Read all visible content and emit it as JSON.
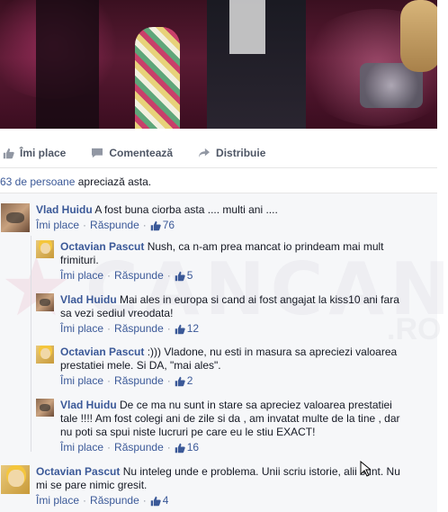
{
  "post_actions": {
    "like": "Îmi place",
    "comment": "Comentează",
    "share": "Distribuie"
  },
  "likes_summary": {
    "count_text": "63 de persoane",
    "suffix": " apreciază asta."
  },
  "watermark": {
    "text": "CANCAN",
    "suffix": ".RO"
  },
  "comments": [
    {
      "author": "Vlad Huidu",
      "text": "A fost buna ciorba asta .... multi ani ....",
      "like_label": "Îmi place",
      "reply_label": "Răspunde",
      "likes": "76"
    },
    {
      "author": "Octavian Pascut",
      "text_line1": "Nush, ca n-am prea mancat io prindeam mai mult",
      "text_line2": "frimituri.",
      "like_label": "Îmi place",
      "reply_label": "Răspunde",
      "likes": "5"
    },
    {
      "author": "Vlad Huidu",
      "text_line1": "Mai ales in europa si cand ai fost angajat la kiss10 ani fara",
      "text_line2": "sa vezi sediul vreodata!",
      "like_label": "Îmi place",
      "reply_label": "Răspunde",
      "likes": "12"
    },
    {
      "author": "Octavian Pascut",
      "text_line1": ":))) Vladone, nu esti in masura sa apreciezi valoarea",
      "text_line2": "prestatiei mele. Si DA, \"mai ales\".",
      "like_label": "Îmi place",
      "reply_label": "Răspunde",
      "likes": "2"
    },
    {
      "author": "Vlad Huidu",
      "text_line1": "De ce ma nu sunt in stare sa apreciez valoarea prestatiei",
      "text_line2": "tale !!!! Am fost colegi ani de zile si da , am invatat multe de la tine , dar",
      "text_line3": "nu poti sa spui niste lucruri pe care eu le stiu EXACT!",
      "like_label": "Îmi place",
      "reply_label": "Răspunde",
      "likes": "16"
    },
    {
      "author": "Octavian Pascut",
      "text_line1": "Nu inteleg unde e problema. Unii scriu istorie, alii sunt. Nu",
      "text_line2": "mi se pare nimic gresit.",
      "like_label": "Îmi place",
      "reply_label": "Răspunde",
      "likes": "4"
    }
  ]
}
